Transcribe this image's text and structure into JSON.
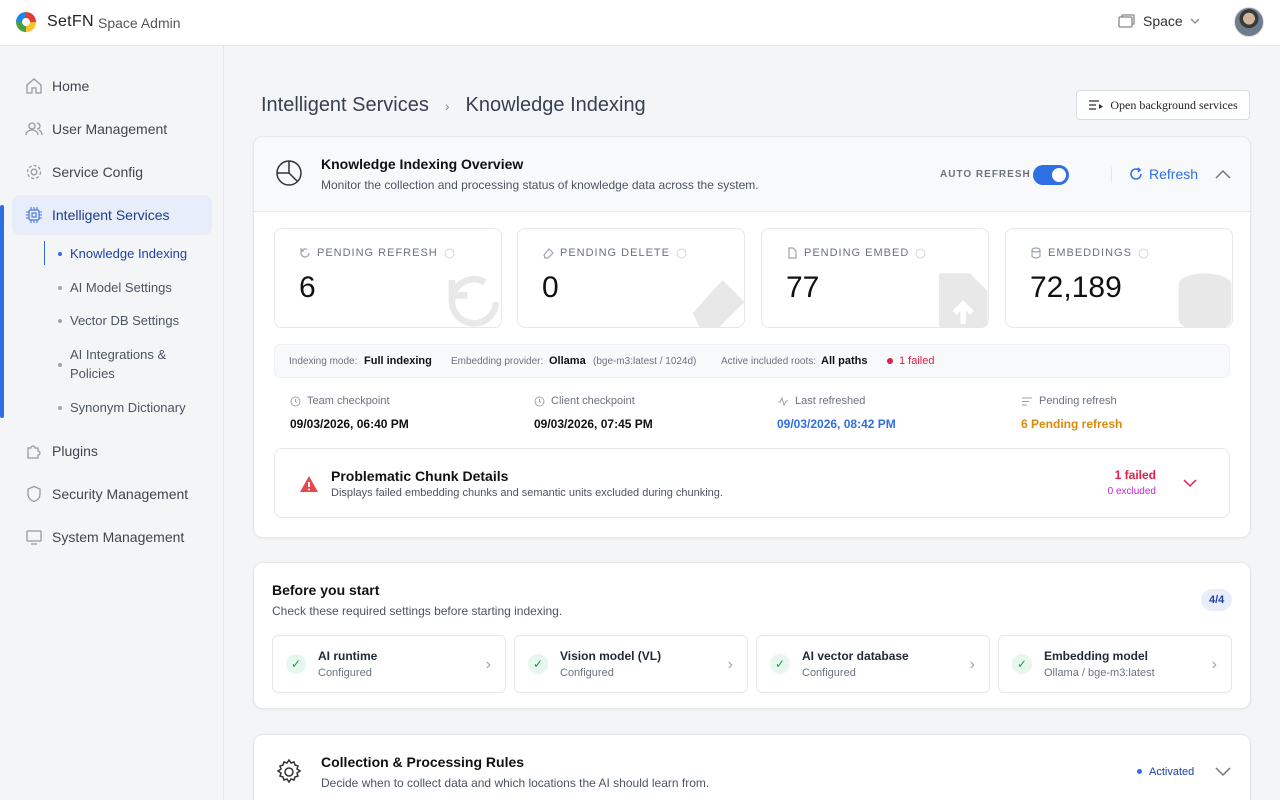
{
  "topbar": {
    "brand": "SetFN",
    "subtitle": "Space Admin",
    "space_label": "Space"
  },
  "sidebar": {
    "items": [
      {
        "label": "Home"
      },
      {
        "label": "User Management"
      },
      {
        "label": "Service Config"
      },
      {
        "label": "Intelligent Services"
      },
      {
        "label": "Plugins"
      },
      {
        "label": "Security Management"
      },
      {
        "label": "System Management"
      }
    ],
    "subitems": [
      {
        "label": "Knowledge Indexing"
      },
      {
        "label": "AI Model Settings"
      },
      {
        "label": "Vector DB Settings"
      },
      {
        "label": "AI Integrations & Policies"
      },
      {
        "label": "Synonym Dictionary"
      }
    ]
  },
  "breadcrumb": {
    "parent": "Intelligent Services",
    "separator": "›",
    "current": "Knowledge Indexing"
  },
  "header": {
    "open_bg_label": "Open background services"
  },
  "overview": {
    "title": "Knowledge Indexing Overview",
    "description": "Monitor the collection and processing status of knowledge data across the system.",
    "auto_refresh_label": "AUTO REFRESH",
    "auto_refresh_on": true,
    "refresh_label": "Refresh",
    "stats": [
      {
        "label": "PENDING REFRESH",
        "value": "6",
        "icon": "refresh-icon"
      },
      {
        "label": "PENDING DELETE",
        "value": "0",
        "icon": "eraser-icon"
      },
      {
        "label": "PENDING EMBED",
        "value": "77",
        "icon": "file-upload-icon"
      },
      {
        "label": "EMBEDDINGS",
        "value": "72,189",
        "icon": "database-icon"
      }
    ],
    "info": {
      "mode_label": "Indexing mode:",
      "mode_value": "Full indexing",
      "provider_label": "Embedding provider:",
      "provider_value": "Ollama",
      "provider_detail": "(bge-m3:latest / 1024d)",
      "roots_label": "Active included roots:",
      "roots_value": "All paths",
      "failed": "1 failed"
    },
    "checkpoints": [
      {
        "label": "Team checkpoint",
        "value": "09/03/2026, 06:40 PM"
      },
      {
        "label": "Client checkpoint",
        "value": "09/03/2026, 07:45 PM"
      },
      {
        "label": "Last refreshed",
        "value": "09/03/2026, 08:42 PM"
      },
      {
        "label": "Pending refresh",
        "value": "6 Pending refresh"
      }
    ],
    "problem": {
      "title": "Problematic Chunk Details",
      "description": "Displays failed embedding chunks and semantic units excluded during chunking.",
      "failed": "1 failed",
      "excluded": "0 excluded"
    }
  },
  "before": {
    "title": "Before you start",
    "description": "Check these required settings before starting indexing.",
    "badge": "4/4",
    "items": [
      {
        "title": "AI runtime",
        "status": "Configured"
      },
      {
        "title": "Vision model (VL)",
        "status": "Configured"
      },
      {
        "title": "AI vector database",
        "status": "Configured"
      },
      {
        "title": "Embedding model",
        "status": "Ollama / bge-m3:latest"
      }
    ]
  },
  "rules": {
    "title": "Collection & Processing Rules",
    "description": "Decide when to collect data and which locations the AI should learn from.",
    "status": "Activated"
  },
  "colors": {
    "accent": "#2f6fe4",
    "danger": "#e11d48",
    "warning": "#d98a0b",
    "success": "#16a34a"
  }
}
